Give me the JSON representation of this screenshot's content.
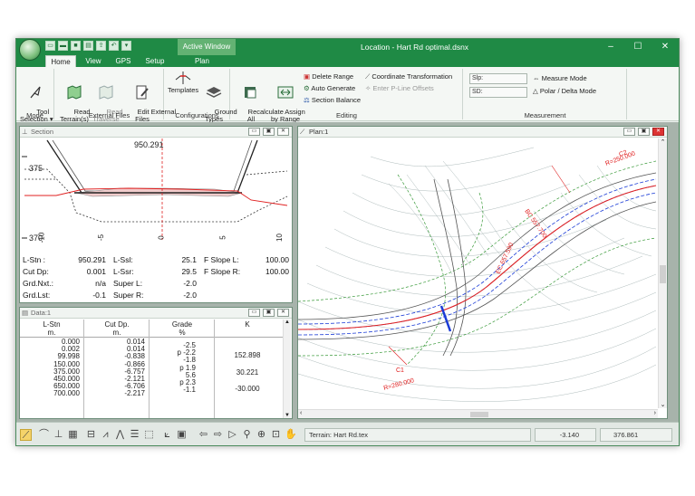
{
  "window": {
    "title": "Location - Hart Rd optimal.dsnx",
    "active_window_tab": "Active Window",
    "min": "–",
    "max": "☐",
    "close": "✕"
  },
  "tabs": [
    "Home",
    "View",
    "GPS",
    "Setup",
    "Plan"
  ],
  "ribbon": {
    "mode": {
      "label": "Mode",
      "tool_selection": "Tool\nSelection ▾"
    },
    "external_files": {
      "label": "External Files",
      "read_terrains": "Read\nTerrain(s)",
      "read_traverse": "Read\nTraverse",
      "edit_external": "Edit External\nFiles"
    },
    "configurations": {
      "label": "Configurations",
      "templates": "Templates",
      "ground_types": "Ground\nTypes"
    },
    "editing": {
      "label": "Editing",
      "recalculate": "Recalculate\nAll",
      "assign_by_range": "Assign\nby Range",
      "delete_range": "Delete Range",
      "auto_generate": "Auto Generate",
      "section_balance": "Section Balance",
      "coordinate_transformation": "Coordinate Transformation",
      "enter_pline_offsets": "Enter P-Line Offsets"
    },
    "measurement": {
      "label": "Measurement",
      "slp_label": "Slp:",
      "sd_label": "SD:",
      "measure_mode": "Measure Mode",
      "polar_delta_mode": "Polar / Delta Mode"
    }
  },
  "section": {
    "title": "Section",
    "elevation_top": "950.291",
    "y_labels": [
      "375",
      "370"
    ],
    "x_labels": [
      "-10",
      "-5",
      "0",
      "5",
      "10"
    ],
    "info": [
      {
        "k1": "L-Stn :",
        "v1": "950.291",
        "k2": "L-Ssl:",
        "v2": "25.1",
        "k3": "F Slope L:",
        "v3": "100.00"
      },
      {
        "k1": "Cut Dp:",
        "v1": "0.001",
        "k2": "L-Ssr:",
        "v2": "29.5",
        "k3": "F Slope R:",
        "v3": "100.00"
      },
      {
        "k1": "Grd.Nxt.:",
        "v1": "n/a",
        "k2": "Super L:",
        "v2": "-2.0",
        "k3": "",
        "v3": ""
      },
      {
        "k1": "Grd.Lst:",
        "v1": "-0.1",
        "k2": "Super R:",
        "v2": "-2.0",
        "k3": "",
        "v3": ""
      }
    ]
  },
  "data_window": {
    "title": "Data:1",
    "headers": [
      {
        "top": "L-Stn",
        "unit": "m."
      },
      {
        "top": "Cut Dp.",
        "unit": "m."
      },
      {
        "top": "Grade",
        "unit": "%"
      },
      {
        "top": "K",
        "unit": ""
      }
    ],
    "lstn": [
      "0.000",
      "0.002",
      "99.998",
      "150.000",
      "375.000",
      "450.000",
      "650.000",
      "700.000"
    ],
    "cut": [
      "0.014",
      "0.014",
      "-0.838",
      "-0.866",
      "-6.757",
      "-2.121",
      "-6.706",
      "-2.217"
    ],
    "grade": [
      "-2.5",
      "p -2.2",
      "-1.8",
      "p 1.9",
      "5.6",
      "p 2.3",
      "-1.1"
    ],
    "k": [
      "152.898",
      "30.221",
      "-30.000"
    ]
  },
  "plan": {
    "title": "Plan:1",
    "labels": {
      "c2": "C2",
      "r250": "R=250.000",
      "bc": "BC 557.700",
      "ec": "EC 657.590",
      "c1": "C1",
      "r280": "R=280.000"
    }
  },
  "statusbar": {
    "terrain": "Terrain: Hart Rd.tex",
    "value1": "-3.140",
    "value2": "376.861"
  },
  "colors": {
    "title_green": "#1f8a45",
    "active_window": "#63b273",
    "alignment_red": "#e02020",
    "proposed_blue": "#1a3bd6",
    "ground_green": "#3a9a3a"
  }
}
